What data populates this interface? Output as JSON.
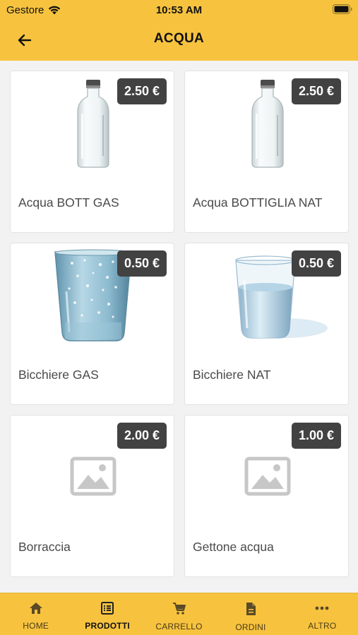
{
  "status": {
    "carrier": "Gestore",
    "time": "10:53 AM"
  },
  "header": {
    "title": "ACQUA"
  },
  "products": [
    {
      "name": "Acqua BOTT GAS",
      "price": "2.50 €",
      "image": "glass-bottle"
    },
    {
      "name": "Acqua BOTTIGLIA NAT",
      "price": "2.50 €",
      "image": "glass-bottle"
    },
    {
      "name": "Bicchiere GAS",
      "price": "0.50 €",
      "image": "sparkling-water-glass"
    },
    {
      "name": "Bicchiere NAT",
      "price": "0.50 €",
      "image": "still-water-glass"
    },
    {
      "name": "Borraccia",
      "price": "2.00 €",
      "image": "image-placeholder-icon"
    },
    {
      "name": "Gettone acqua",
      "price": "1.00 €",
      "image": "image-placeholder-icon"
    }
  ],
  "tabs": [
    {
      "label": "HOME",
      "icon": "home-icon",
      "active": false
    },
    {
      "label": "PRODOTTI",
      "icon": "product-list-icon",
      "active": true
    },
    {
      "label": "CARRELLO",
      "icon": "cart-icon",
      "active": false
    },
    {
      "label": "ORDINI",
      "icon": "document-icon",
      "active": false
    },
    {
      "label": "ALTRO",
      "icon": "more-icon",
      "active": false
    }
  ],
  "colors": {
    "accent": "#f7c33f",
    "badge": "#424242",
    "background": "#f2f2f2"
  }
}
